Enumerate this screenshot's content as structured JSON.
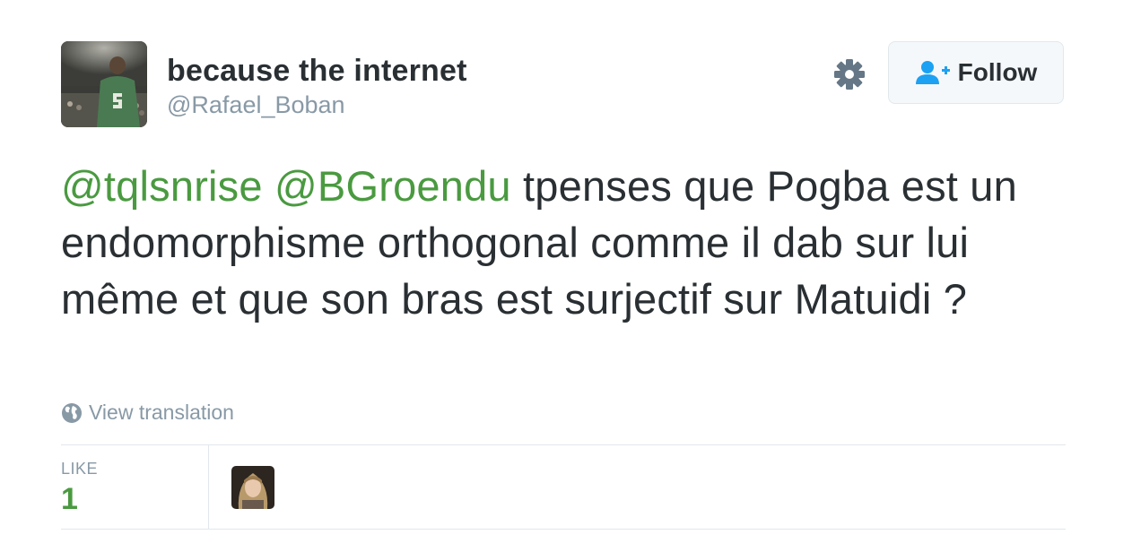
{
  "user": {
    "display_name": "because the internet",
    "handle": "@Rafael_Boban",
    "avatar_icon": "basketball-player-avatar"
  },
  "header": {
    "settings_icon": "gear-icon",
    "follow_label": "Follow",
    "follow_icon": "add-user-icon"
  },
  "tweet": {
    "mention1": "@tqlsnrise",
    "mention2": "@BGroendu",
    "text": "tpenses que Pogba est un endomorphisme orthogonal comme il dab sur lui même et que son bras est surjectif sur Matuidi ?"
  },
  "translation": {
    "label": "View translation",
    "icon": "globe-icon"
  },
  "stats": {
    "like_label": "LIKE",
    "like_count": "1"
  },
  "likers": [
    {
      "icon": "liker-avatar"
    }
  ],
  "colors": {
    "mention": "#4a9a40",
    "text": "#292f33",
    "muted": "#8899a6",
    "border": "#e1e8ed",
    "follow_icon": "#1da1f2"
  }
}
